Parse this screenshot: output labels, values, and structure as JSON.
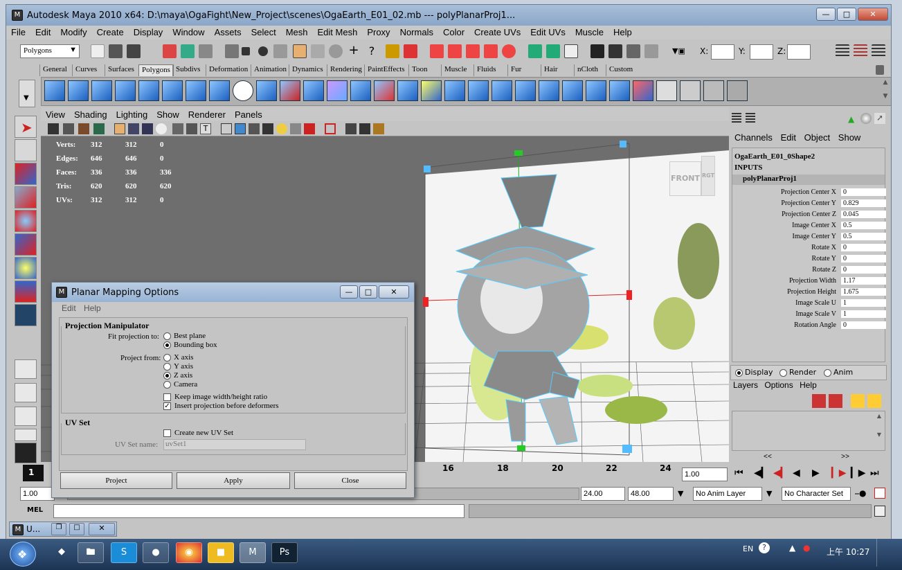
{
  "window": {
    "title": "Autodesk Maya 2010 x64: D:\\maya\\OgaFight\\New_Project\\scenes\\OgaEarth_E01_02.mb   ---   polyPlanarProj1..."
  },
  "menubar": [
    "File",
    "Edit",
    "Modify",
    "Create",
    "Display",
    "Window",
    "Assets",
    "Select",
    "Mesh",
    "Edit Mesh",
    "Proxy",
    "Normals",
    "Color",
    "Create UVs",
    "Edit UVs",
    "Muscle",
    "Help"
  ],
  "statusline": {
    "mode": "Polygons",
    "x_label": "X:",
    "y_label": "Y:",
    "z_label": "Z:"
  },
  "shelf_tabs": [
    "General",
    "Curves",
    "Surfaces",
    "Polygons",
    "Subdivs",
    "Deformation",
    "Animation",
    "Dynamics",
    "Rendering",
    "PaintEffects",
    "Toon",
    "Muscle",
    "Fluids",
    "Fur",
    "Hair",
    "nCloth",
    "Custom"
  ],
  "shelf_active": "Polygons",
  "viewport": {
    "menu": [
      "View",
      "Shading",
      "Lighting",
      "Show",
      "Renderer",
      "Panels"
    ],
    "hud": [
      {
        "label": "Verts:",
        "a": "312",
        "b": "312",
        "c": "0"
      },
      {
        "label": "Edges:",
        "a": "646",
        "b": "646",
        "c": "0"
      },
      {
        "label": "Faces:",
        "a": "336",
        "b": "336",
        "c": "336"
      },
      {
        "label": "Tris:",
        "a": "620",
        "b": "620",
        "c": "620"
      },
      {
        "label": "UVs:",
        "a": "312",
        "b": "312",
        "c": "0"
      }
    ],
    "viewcube_label": "FRONT",
    "viewcube_side": "RGT"
  },
  "channel_box": {
    "menu": [
      "Channels",
      "Edit",
      "Object",
      "Show"
    ],
    "shape": "OgaEarth_E01_0Shape2",
    "inputs": "INPUTS",
    "node": "polyPlanarProj1",
    "attrs": [
      {
        "name": "Projection Center X",
        "value": "0"
      },
      {
        "name": "Projection Center Y",
        "value": "0.829"
      },
      {
        "name": "Projection Center Z",
        "value": "0.045"
      },
      {
        "name": "Image Center X",
        "value": "0.5"
      },
      {
        "name": "Image Center Y",
        "value": "0.5"
      },
      {
        "name": "Rotate X",
        "value": "0"
      },
      {
        "name": "Rotate Y",
        "value": "0"
      },
      {
        "name": "Rotate Z",
        "value": "0"
      },
      {
        "name": "Projection Width",
        "value": "1.17"
      },
      {
        "name": "Projection Height",
        "value": "1.675"
      },
      {
        "name": "Image Scale U",
        "value": "1"
      },
      {
        "name": "Image Scale V",
        "value": "1"
      },
      {
        "name": "Rotation Angle",
        "value": "0"
      }
    ],
    "layer_modes": [
      "Display",
      "Render",
      "Anim"
    ],
    "layer_menu": [
      "Layers",
      "Options",
      "Help"
    ],
    "nav_left": "<<",
    "nav_right": ">>"
  },
  "dialog": {
    "title": "Planar Mapping Options",
    "menu": [
      "Edit",
      "Help"
    ],
    "section1": "Projection Manipulator",
    "fit_label": "Fit projection to:",
    "fit_options": [
      "Best plane",
      "Bounding box"
    ],
    "fit_selected": 1,
    "project_label": "Project from:",
    "project_options": [
      "X axis",
      "Y axis",
      "Z axis",
      "Camera"
    ],
    "project_selected": 2,
    "keep_ratio": "Keep image width/height ratio",
    "insert_proj": "Insert projection before deformers",
    "section2": "UV Set",
    "create_uvset": "Create new UV Set",
    "uvset_label": "UV Set name:",
    "uvset_value": "uvSet1",
    "buttons": [
      "Project",
      "Apply",
      "Close"
    ]
  },
  "timeline": {
    "current_frame": "1",
    "ticks": [
      "16",
      "18",
      "20",
      "22",
      "24"
    ],
    "current_time": "1.00"
  },
  "range": {
    "start": "1.00",
    "end": "24.00",
    "anim_end": "48.00",
    "anim_layer": "No Anim Layer",
    "char_set": "No Character Set"
  },
  "mel": {
    "label": "MEL"
  },
  "minimized": {
    "label": "U..."
  },
  "taskbar": {
    "lang": "EN",
    "time": "上午 10:27"
  }
}
